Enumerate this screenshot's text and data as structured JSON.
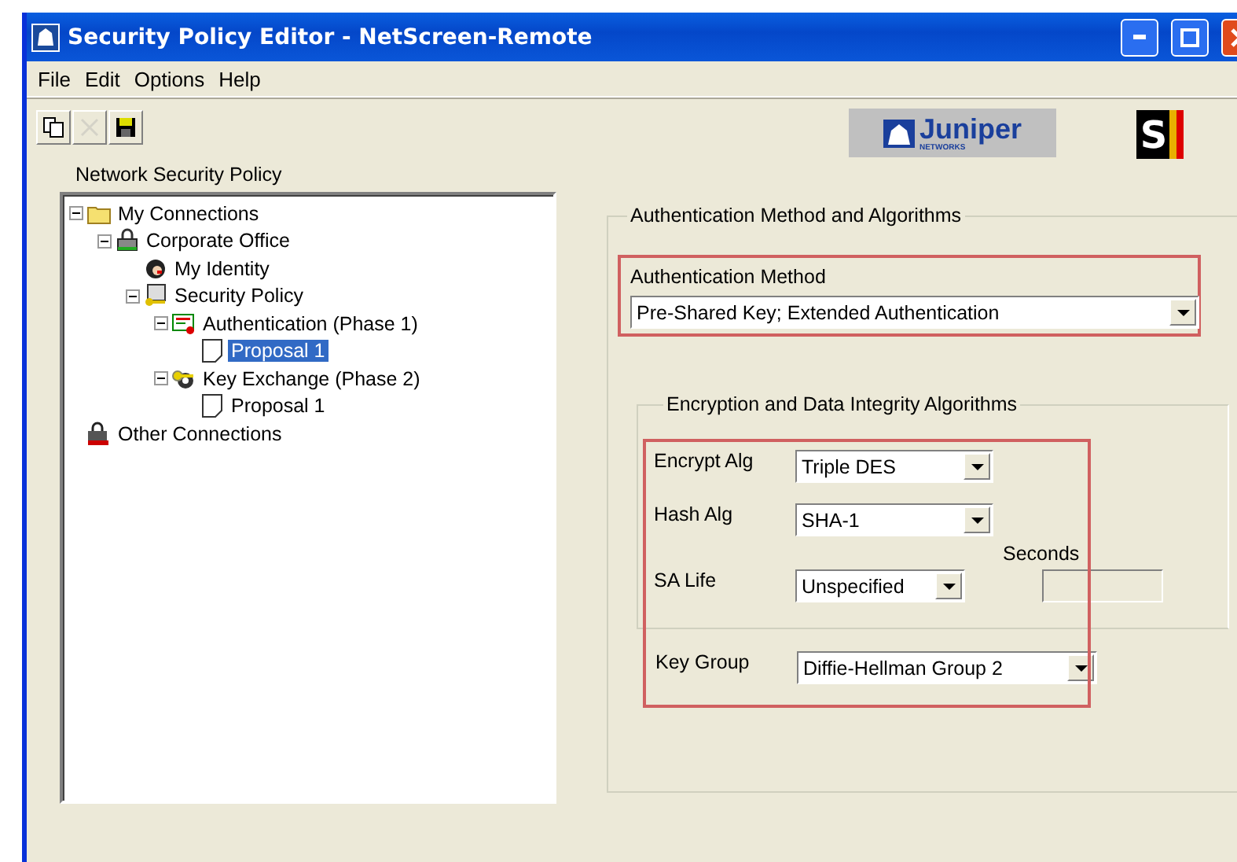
{
  "window": {
    "title": "Security Policy Editor - NetScreen-Remote"
  },
  "menu": [
    "File",
    "Edit",
    "Options",
    "Help"
  ],
  "toolbar": [
    {
      "kind": "copy",
      "disabled": false
    },
    {
      "kind": "delete",
      "disabled": true
    },
    {
      "kind": "save",
      "disabled": false
    }
  ],
  "logo": {
    "name": "Juniper",
    "sub": "NETWORKS",
    "badge": "S"
  },
  "tree": {
    "title": "Network Security Policy",
    "items": [
      {
        "label": "My Connections",
        "kind": "folder",
        "expanded": true,
        "selected": false,
        "children": [
          {
            "label": "Corporate Office",
            "kind": "connection",
            "expanded": true,
            "selected": false,
            "children": [
              {
                "label": "My Identity",
                "kind": "identity",
                "selected": false
              },
              {
                "label": "Security Policy",
                "kind": "policy",
                "expanded": true,
                "selected": false,
                "children": [
                  {
                    "label": "Authentication (Phase 1)",
                    "kind": "auth",
                    "expanded": true,
                    "selected": false,
                    "children": [
                      {
                        "label": "Proposal 1",
                        "kind": "proposal",
                        "selected": true
                      }
                    ]
                  },
                  {
                    "label": "Key Exchange (Phase 2)",
                    "kind": "key",
                    "expanded": true,
                    "selected": false,
                    "children": [
                      {
                        "label": "Proposal 1",
                        "kind": "proposal",
                        "selected": false
                      }
                    ]
                  }
                ]
              }
            ]
          }
        ]
      },
      {
        "label": "Other Connections",
        "kind": "other",
        "selected": false
      }
    ]
  },
  "panel": {
    "title": "Authentication Method and Algorithms",
    "auth_method": {
      "label": "Authentication Method",
      "value": "Pre-Shared Key; Extended Authentication"
    },
    "algorithms": {
      "title": "Encryption and Data Integrity Algorithms",
      "encrypt": {
        "label": "Encrypt Alg",
        "value": "Triple DES"
      },
      "hash": {
        "label": "Hash Alg",
        "value": "SHA-1"
      },
      "seconds_label": "Seconds",
      "sa_life": {
        "label": "SA Life",
        "value": "Unspecified"
      },
      "seconds_field": {
        "disabled": true
      }
    },
    "key_group": {
      "label": "Key Group",
      "value": "Diffie-Hellman Group 2"
    }
  }
}
